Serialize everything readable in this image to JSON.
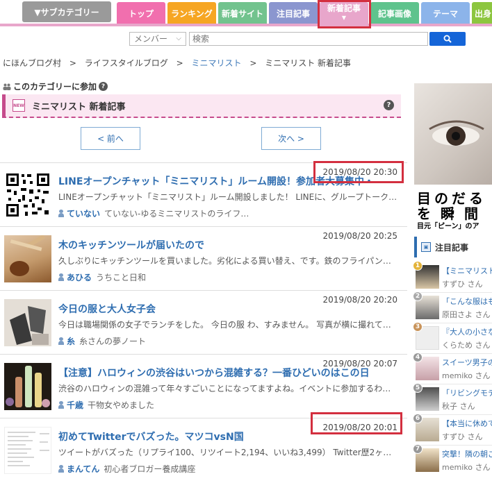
{
  "header": {
    "subcategory_button": "▼サブカテゴリー",
    "tabs": [
      {
        "label": "トップ",
        "color": "#f16fae"
      },
      {
        "label": "ランキング",
        "color": "#f6a623"
      },
      {
        "label": "新着サイト",
        "color": "#72c38e"
      },
      {
        "label": "注目記事",
        "color": "#8b96cf"
      },
      {
        "label": "新着記事",
        "color": "#e8a6cb"
      },
      {
        "label": "記事画像",
        "color": "#5ec38d"
      },
      {
        "label": "テーマ",
        "color": "#8cb4ea"
      },
      {
        "label": "出身",
        "color": "#8dc63f"
      }
    ],
    "active_tab": "新着記事"
  },
  "search": {
    "scope_selected": "メンバー",
    "placeholder": "検索"
  },
  "breadcrumb": {
    "items": [
      "にほんブログ村",
      "ライフスタイルブログ",
      "ミニマリスト",
      "ミニマリスト 新着記事"
    ],
    "separator": ">"
  },
  "join_category": "このカテゴリーに参加",
  "section": {
    "new_badge": "NEW",
    "title": "ミニマリスト 新着記事"
  },
  "pagination": {
    "prev": "< 前へ",
    "next": "次へ >"
  },
  "articles": [
    {
      "date": "2019/08/20 20:30",
      "title": "LINEオープンチャット「ミニマリスト」ルーム開設！参加者大募集中・",
      "desc": "LINEオープンチャット「ミニマリスト」ルーム開設しました！ LINEに、グループトーク…",
      "author": "ていない",
      "blog": "ていない-ゆるミニマリストのライフ…",
      "thumb": "qr"
    },
    {
      "date": "2019/08/20 20:25",
      "title": "木のキッチンツールが届いたので",
      "desc": "久しぶりにキッチンツールを買いました。劣化による買い替え、です。鉄のフライパンが…",
      "author": "あひる",
      "blog": "うちこと日和",
      "thumb": "wood"
    },
    {
      "date": "2019/08/20 20:20",
      "title": "今日の服と大人女子会",
      "desc": "今日は職場関係の女子でランチをした。 今日の服 わ、すみません。 写真が横に撮れて…",
      "author": "糸",
      "blog": "糸さんの夢ノート",
      "thumb": "clothes"
    },
    {
      "date": "2019/08/20 20:07",
      "title": "【注意】ハロウィンの渋谷はいつから混雑する？一番ひどいのはこの日",
      "desc": "渋谷のハロウィンの混雑って年々すごいことになってますよね。イベントに参加するわけ…",
      "author": "千歳",
      "blog": "干物女やめました",
      "thumb": "bottles"
    },
    {
      "date": "2019/08/20 20:01",
      "title": "初めてTwitterでバズった。マツコvsN国",
      "desc": "ツイートがバズった（リプライ100、リツイート2,194、いいね3,499） Twitter歴2ヶ月…",
      "author": "まんてん",
      "blog": "初心者ブロガー養成講座",
      "thumb": "screen"
    }
  ],
  "ad": {
    "line1": "目のだる",
    "line2": "を瞬間",
    "line3": "目元「ピーン」のア"
  },
  "featured": {
    "title": "注目記事",
    "items": [
      {
        "rank": "1",
        "title": "【ミニマリスト",
        "author": "すずひ さん"
      },
      {
        "rank": "2",
        "title": "「こんな服はも",
        "author": "原田さよ さん"
      },
      {
        "rank": "3",
        "title": "『大人の小さな",
        "author": "くらため さん"
      },
      {
        "rank": "4",
        "title": "スイーツ男子の",
        "author": "memiko さん"
      },
      {
        "rank": "5",
        "title": "「リビングモテ",
        "author": "秋子 さん"
      },
      {
        "rank": "6",
        "title": "【本当に休めて",
        "author": "すずひ さん"
      },
      {
        "rank": "7",
        "title": "突撃！隣の朝ご",
        "author": "memiko さん"
      }
    ]
  }
}
